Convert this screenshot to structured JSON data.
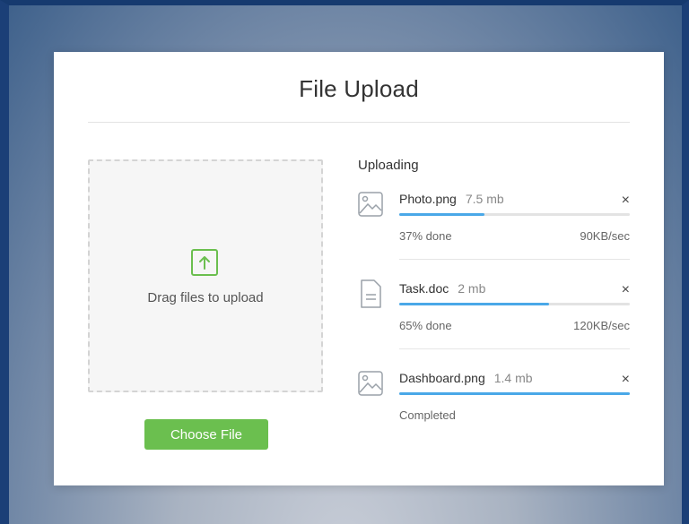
{
  "card": {
    "title": "File Upload",
    "dropzone_text": "Drag files to upload",
    "choose_button": "Choose File"
  },
  "uploads": {
    "heading": "Uploading",
    "items": [
      {
        "name": "Photo.png",
        "size": "7.5 mb",
        "status": "37% done",
        "speed": "90KB/sec",
        "progress": 0.37,
        "icon": "image-icon"
      },
      {
        "name": "Task.doc",
        "size": "2 mb",
        "status": "65% done",
        "speed": "120KB/sec",
        "progress": 0.65,
        "icon": "document-icon"
      },
      {
        "name": "Dashboard.png",
        "size": "1.4 mb",
        "status": "Completed",
        "speed": "",
        "progress": 1.0,
        "icon": "image-icon"
      }
    ],
    "close_label": "×"
  },
  "colors": {
    "accent_green": "#6bbf4f",
    "progress_blue": "#4aa8e8"
  }
}
